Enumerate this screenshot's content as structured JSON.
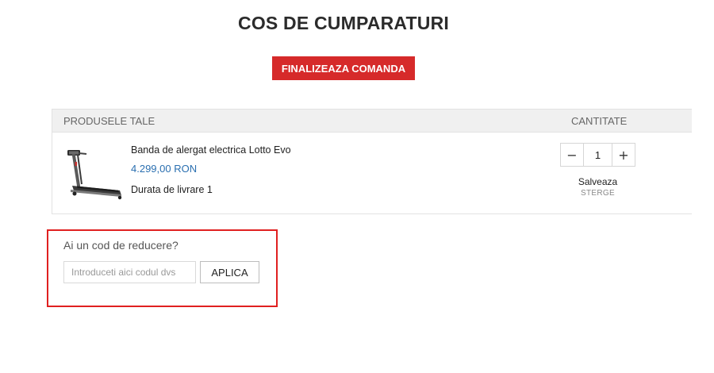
{
  "page": {
    "title": "COS DE CUMPARATURI"
  },
  "checkout": {
    "label": "FINALIZEAZA COMANDA"
  },
  "cart": {
    "headers": {
      "products": "PRODUSELE TALE",
      "quantity": "CANTITATE"
    },
    "items": [
      {
        "name": "Banda de alergat electrica Lotto Evo",
        "price": "4.299,00 RON",
        "delivery": "Durata de livrare 1",
        "quantity": "1",
        "save_label": "Salveaza",
        "remove_label": "STERGE",
        "image_icon": "treadmill-image"
      }
    ],
    "decrement_label": "−",
    "increment_label": "+"
  },
  "discount": {
    "title": "Ai un cod de reducere?",
    "placeholder": "Introduceti aici codul dvs",
    "value": "",
    "apply_label": "APLICA"
  },
  "colors": {
    "accent": "#d62a2a",
    "price": "#2a6fb0",
    "highlight_border": "#e02020"
  }
}
